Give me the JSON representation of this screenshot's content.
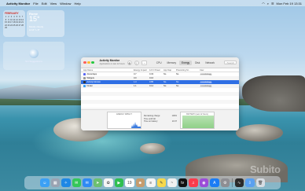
{
  "menubar": {
    "app_name": "Activity Monitor",
    "menus": [
      "File",
      "Edit",
      "View",
      "Window",
      "Help"
    ],
    "clock": "Mon Feb 19 13:31"
  },
  "widgets": {
    "calendar": {
      "month": "FEBRUARY",
      "days": [
        "1",
        "2",
        "3",
        "4",
        "5",
        "6",
        "7",
        "8",
        "9",
        "10",
        "11",
        "12",
        "13",
        "14",
        "15",
        "16",
        "17",
        "18",
        "19",
        "20",
        "21",
        "22",
        "23",
        "24",
        "25",
        "26",
        "27",
        "28",
        "29"
      ]
    },
    "weather": {
      "city": "Rome",
      "temp": "15°",
      "condition": "Mostly cloudy",
      "high_low": "H:16° L:8°"
    },
    "siri": {
      "caption": "Siri Suggestions"
    }
  },
  "window": {
    "title": "Activity Monitor",
    "subtitle": "Applications in last 12 hours",
    "tabs": [
      "CPU",
      "Memory",
      "Energy",
      "Disk",
      "Network"
    ],
    "active_tab": "Energy",
    "search_placeholder": "Search",
    "columns": [
      "App Name",
      "Energy Impact",
      "12 hr Power",
      "App Nap",
      "Preventing Sl...",
      "User"
    ],
    "rows": [
      {
        "name": "discordapp",
        "icon": "discord-icon",
        "energy": "0.7",
        "power": "0.33",
        "app_nap": "No",
        "preventing": "No",
        "user": "mrcarlosbagg"
      },
      {
        "name": "Widgets",
        "icon": "widgets-icon",
        "energy": "0.0",
        "power": "0.16",
        "app_nap": "",
        "preventing": "",
        "user": ""
      },
      {
        "name": "Activity Monitor",
        "icon": "activity-monitor-icon",
        "energy": "1.3",
        "power": "0.85",
        "app_nap": "No",
        "preventing": "No",
        "user": "mrcarlosbagg"
      },
      {
        "name": "Finder",
        "icon": "finder-icon",
        "energy": "1.1",
        "power": "0.12",
        "app_nap": "No",
        "preventing": "No",
        "user": "mrcarlosbagg"
      }
    ],
    "selected_row": 2,
    "energy_label": "ENERGY IMPACT",
    "battery_label": "BATTERY (Last 12 hours)",
    "stats": [
      {
        "label": "Remaining charge:",
        "value": "100%"
      },
      {
        "label": "Time until full:",
        "value": ""
      },
      {
        "label": "Time on battery:",
        "value": "10:37"
      }
    ],
    "battery_level": 1.0
  },
  "dock": {
    "icons": [
      {
        "name": "finder-icon",
        "color": "#3ba0f5",
        "glyph": "☺"
      },
      {
        "name": "launchpad-icon",
        "color": "#9aa3b2",
        "glyph": "▦"
      },
      {
        "name": "safari-icon",
        "color": "#1e88e5",
        "glyph": "✧"
      },
      {
        "name": "messages-icon",
        "color": "#34c759",
        "glyph": "✉"
      },
      {
        "name": "mail-icon",
        "color": "#2f8af5",
        "glyph": "✉"
      },
      {
        "name": "maps-icon",
        "color": "#6cc070",
        "glyph": "➤"
      },
      {
        "name": "photos-icon",
        "color": "#f5f5f5",
        "glyph": "✿"
      },
      {
        "name": "facetime-icon",
        "color": "#2fbf4f",
        "glyph": "▶"
      },
      {
        "name": "calendar-icon",
        "color": "#ffffff",
        "glyph": "19"
      },
      {
        "name": "contacts-icon",
        "color": "#c69c6d",
        "glyph": "☻"
      },
      {
        "name": "reminders-icon",
        "color": "#f4f4f4",
        "glyph": "≡"
      },
      {
        "name": "notes-icon",
        "color": "#f7d84b",
        "glyph": "✎"
      },
      {
        "name": "freeform-icon",
        "color": "#f0f0f0",
        "glyph": "~"
      },
      {
        "name": "appletv-icon",
        "color": "#111111",
        "glyph": "tv"
      },
      {
        "name": "music-icon",
        "color": "#fa3c4c",
        "glyph": "♫"
      },
      {
        "name": "podcasts-icon",
        "color": "#9b4dd8",
        "glyph": "◉"
      },
      {
        "name": "appstore-icon",
        "color": "#1b7cf5",
        "glyph": "A"
      },
      {
        "name": "settings-icon",
        "color": "#8e8e93",
        "glyph": "⚙"
      },
      {
        "name": "activity-monitor-dock-icon",
        "color": "#2a2a2a",
        "glyph": "∿"
      },
      {
        "name": "downloads-icon",
        "color": "#5aa0f0",
        "glyph": "⇩"
      },
      {
        "name": "trash-icon",
        "color": "#d8dde3",
        "glyph": "🗑"
      }
    ]
  },
  "watermark": "Subito"
}
